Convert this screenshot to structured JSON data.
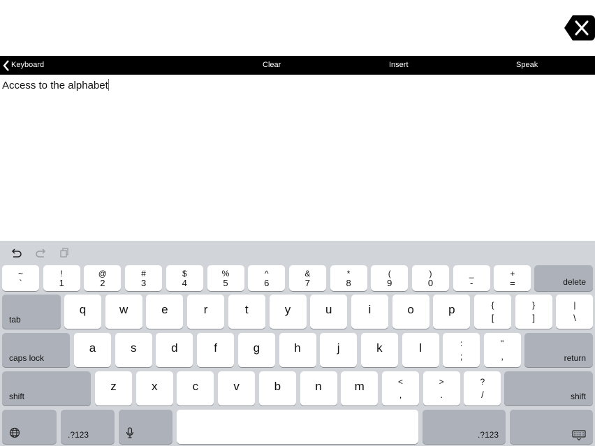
{
  "close_button": {
    "icon": "close-x-icon"
  },
  "toolbar": {
    "back_label": "Keyboard",
    "clear_label": "Clear",
    "insert_label": "Insert",
    "speak_label": "Speak"
  },
  "editor": {
    "text": "Access to the alphabet"
  },
  "assistant_bar": {
    "icons": [
      "undo-icon",
      "redo-icon",
      "paste-icon"
    ]
  },
  "keyboard": {
    "row1": [
      {
        "top": "~",
        "bot": "`"
      },
      {
        "top": "!",
        "bot": "1"
      },
      {
        "top": "@",
        "bot": "2"
      },
      {
        "top": "#",
        "bot": "3"
      },
      {
        "top": "$",
        "bot": "4"
      },
      {
        "top": "%",
        "bot": "5"
      },
      {
        "top": "^",
        "bot": "6"
      },
      {
        "top": "&",
        "bot": "7"
      },
      {
        "top": "*",
        "bot": "8"
      },
      {
        "top": "(",
        "bot": "9"
      },
      {
        "top": ")",
        "bot": "0"
      },
      {
        "top": "_",
        "bot": "-"
      },
      {
        "top": "+",
        "bot": "="
      }
    ],
    "delete_label": "delete",
    "tab_label": "tab",
    "row2": [
      "q",
      "w",
      "e",
      "r",
      "t",
      "y",
      "u",
      "i",
      "o",
      "p"
    ],
    "row2_sym": [
      {
        "top": "{",
        "bot": "["
      },
      {
        "top": "}",
        "bot": "]"
      },
      {
        "top": "|",
        "bot": "\\"
      }
    ],
    "caps_label": "caps lock",
    "row3": [
      "a",
      "s",
      "d",
      "f",
      "g",
      "h",
      "j",
      "k",
      "l"
    ],
    "row3_sym": [
      {
        "top": ":",
        "bot": ";"
      },
      {
        "top": "\"",
        "bot": ","
      }
    ],
    "return_label": "return",
    "shift_label": "shift",
    "row4": [
      "z",
      "x",
      "c",
      "v",
      "b",
      "n",
      "m"
    ],
    "row4_sym": [
      {
        "top": "<",
        "bot": ","
      },
      {
        "top": ">",
        "bot": "."
      },
      {
        "top": "?",
        "bot": "/"
      }
    ],
    "numbers_label": ".?123"
  }
}
